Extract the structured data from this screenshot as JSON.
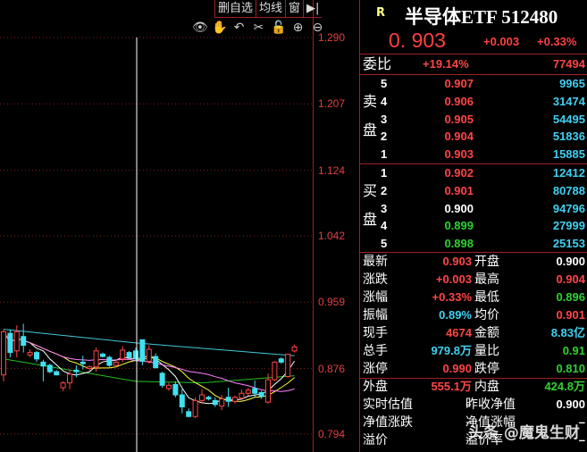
{
  "toolbar": {
    "items": [
      "删自选",
      "均线",
      "窗"
    ],
    "end": "▶|"
  },
  "tools": [
    "👁",
    "✋",
    "↶",
    "✂",
    "🔓",
    "⊕",
    "⊖"
  ],
  "colors": {
    "up": "#ff4545",
    "down": "#40e0f0"
  },
  "chart_data": {
    "type": "candlestick",
    "yticks": [
      "1.290",
      "1.207",
      "1.124",
      "1.042",
      "0.959",
      "0.876",
      "0.794"
    ],
    "ylim": [
      0.794,
      1.29
    ],
    "candles": [
      [
        0.868,
        0.925,
        0.86,
        0.922
      ],
      [
        0.92,
        0.925,
        0.89,
        0.896
      ],
      [
        0.898,
        0.93,
        0.89,
        0.922
      ],
      [
        0.916,
        0.932,
        0.896,
        0.905
      ],
      [
        0.893,
        0.9,
        0.89,
        0.896
      ],
      [
        0.896,
        0.898,
        0.884,
        0.888
      ],
      [
        0.884,
        0.887,
        0.86,
        0.879
      ],
      [
        0.88,
        0.882,
        0.87,
        0.872
      ],
      [
        0.872,
        0.874,
        0.868,
        0.868
      ],
      [
        0.852,
        0.86,
        0.848,
        0.858
      ],
      [
        0.858,
        0.875,
        0.85,
        0.869
      ],
      [
        0.874,
        0.88,
        0.865,
        0.872
      ],
      [
        0.884,
        0.892,
        0.875,
        0.882
      ],
      [
        0.876,
        0.88,
        0.872,
        0.878
      ],
      [
        0.878,
        0.902,
        0.872,
        0.898
      ],
      [
        0.894,
        0.896,
        0.89,
        0.891
      ],
      [
        0.89,
        0.892,
        0.878,
        0.88
      ],
      [
        0.88,
        0.888,
        0.878,
        0.884
      ],
      [
        0.888,
        0.904,
        0.884,
        0.899
      ],
      [
        0.896,
        0.898,
        0.888,
        0.89
      ],
      [
        0.898,
        0.902,
        0.885,
        0.888
      ],
      [
        0.912,
        0.912,
        0.88,
        0.885
      ],
      [
        0.885,
        0.905,
        0.882,
        0.9
      ],
      [
        0.891,
        0.895,
        0.876,
        0.877
      ],
      [
        0.87,
        0.872,
        0.852,
        0.855
      ],
      [
        0.851,
        0.858,
        0.848,
        0.855
      ],
      [
        0.856,
        0.86,
        0.84,
        0.843
      ],
      [
        0.843,
        0.85,
        0.82,
        0.828
      ],
      [
        0.822,
        0.826,
        0.815,
        0.816
      ],
      [
        0.816,
        0.84,
        0.814,
        0.836
      ],
      [
        0.836,
        0.85,
        0.832,
        0.843
      ],
      [
        0.84,
        0.842,
        0.836,
        0.838
      ],
      [
        0.836,
        0.84,
        0.828,
        0.831
      ],
      [
        0.829,
        0.843,
        0.824,
        0.838
      ],
      [
        0.84,
        0.852,
        0.828,
        0.835
      ],
      [
        0.835,
        0.842,
        0.832,
        0.84
      ],
      [
        0.839,
        0.85,
        0.835,
        0.845
      ],
      [
        0.845,
        0.852,
        0.842,
        0.849
      ],
      [
        0.851,
        0.861,
        0.84,
        0.845
      ],
      [
        0.846,
        0.848,
        0.838,
        0.841
      ],
      [
        0.834,
        0.87,
        0.832,
        0.862
      ],
      [
        0.862,
        0.885,
        0.86,
        0.884
      ],
      [
        0.888,
        0.89,
        0.882,
        0.884
      ],
      [
        0.866,
        0.894,
        0.864,
        0.894
      ],
      [
        0.898,
        0.906,
        0.896,
        0.903
      ]
    ],
    "ma_long_cyan": [
      [
        0,
        0.925
      ],
      [
        20,
        0.908
      ],
      [
        44,
        0.892
      ]
    ],
    "ma_long_green": [
      [
        0,
        0.888
      ],
      [
        20,
        0.86
      ],
      [
        30,
        0.858
      ],
      [
        44,
        0.867
      ]
    ],
    "crosshair_index": 20
  },
  "quote": {
    "flag": "R",
    "name": "半导体ETF 512480",
    "price": "0. 903",
    "change": "+0.003",
    "pct": "+0.33%",
    "weibi_label": "委比",
    "weibi": "+19.14%",
    "weicha": "77494",
    "sell_label": [
      "卖",
      "盘"
    ],
    "buy_label": [
      "买",
      "盘"
    ],
    "sell": [
      [
        "5",
        "0.907",
        "9965"
      ],
      [
        "4",
        "0.906",
        "31474"
      ],
      [
        "3",
        "0.905",
        "54495"
      ],
      [
        "2",
        "0.904",
        "51836"
      ],
      [
        "1",
        "0.903",
        "15885"
      ]
    ],
    "buy": [
      [
        "1",
        "0.902",
        "12412",
        "red"
      ],
      [
        "2",
        "0.901",
        "80788",
        "red"
      ],
      [
        "3",
        "0.900",
        "94796",
        "wh"
      ],
      [
        "4",
        "0.899",
        "27999",
        "green"
      ],
      [
        "5",
        "0.898",
        "25153",
        "green"
      ]
    ],
    "stats": [
      [
        "最新",
        "0.903",
        "red",
        "开盘",
        "0.900",
        "wh"
      ],
      [
        "涨跌",
        "+0.003",
        "red",
        "最高",
        "0.904",
        "red"
      ],
      [
        "涨幅",
        "+0.33%",
        "red",
        "最低",
        "0.896",
        "green"
      ],
      [
        "振幅",
        "0.89%",
        "cyan",
        "均价",
        "0.901",
        "red"
      ],
      [
        "现手",
        "4674",
        "red",
        "金额",
        "8.83亿",
        "cyan"
      ],
      [
        "总手",
        "979.8万",
        "cyan",
        "量比",
        "0.91",
        "green"
      ],
      [
        "涨停",
        "0.990",
        "red",
        "跌停",
        "0.810",
        "green"
      ]
    ],
    "outer": [
      "外盘",
      "555.1万",
      "内盘",
      "424.8万"
    ],
    "nav": [
      [
        "实时估值",
        "–",
        "昨收净值",
        "0.900"
      ],
      [
        "净值涨跌",
        "–",
        "净值涨幅",
        "–"
      ],
      [
        "溢价",
        "–",
        "溢价率",
        "–"
      ]
    ]
  },
  "watermark": "头条 @魔鬼生财"
}
